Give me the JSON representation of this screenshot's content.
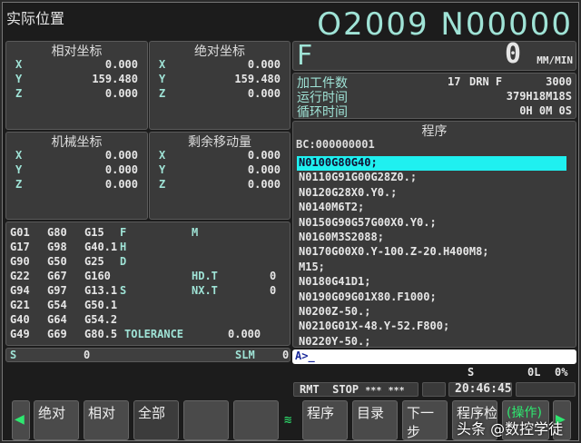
{
  "header": {
    "title": "实际位置",
    "program_no": "O2009 N00000"
  },
  "relative": {
    "title": "相对坐标",
    "axes": [
      {
        "a": "X",
        "v": "0.000"
      },
      {
        "a": "Y",
        "v": "159.480"
      },
      {
        "a": "Z",
        "v": "0.000"
      }
    ]
  },
  "absolute": {
    "title": "绝对坐标",
    "axes": [
      {
        "a": "X",
        "v": "0.000"
      },
      {
        "a": "Y",
        "v": "159.480"
      },
      {
        "a": "Z",
        "v": "0.000"
      }
    ]
  },
  "machine": {
    "title": "机械坐标",
    "axes": [
      {
        "a": "X",
        "v": "0.000"
      },
      {
        "a": "Y",
        "v": "0.000"
      },
      {
        "a": "Z",
        "v": "0.000"
      }
    ]
  },
  "remaining": {
    "title": "剩余移动量",
    "axes": [
      {
        "a": "X",
        "v": "0.000"
      },
      {
        "a": "Y",
        "v": "0.000"
      },
      {
        "a": "Z",
        "v": "0.000"
      }
    ]
  },
  "feed": {
    "label": "F",
    "value": "0",
    "unit": "MM/MIN"
  },
  "info": {
    "parts_label": "加工件数",
    "parts": "17",
    "drn_label": "DRN F",
    "drn": "3000",
    "run_label": "运行时间",
    "run": "379H18M18S",
    "cycle_label": "循环时间",
    "cycle": "0H 0M 0S"
  },
  "gcodes": {
    "c1": [
      "G01",
      "G17",
      "G90",
      "G22",
      "G94",
      "G21",
      "G40",
      "G49"
    ],
    "c2": [
      "G80",
      "G98",
      "G50",
      "G67",
      "G97",
      "G54",
      "G64",
      "G69"
    ],
    "c3": [
      "G15",
      "G40.1",
      "G25",
      "G160",
      "G13.1",
      "G50.1",
      "G54.2",
      "G80.5"
    ],
    "f": "F",
    "h": "H",
    "d": "D",
    "s": "S",
    "m": "M",
    "hdt_label": "HD.T",
    "hdt": "0",
    "nxt_label": "NX.T",
    "nxt": "0",
    "tol_label": "TOLERANCE",
    "tol": "0.000"
  },
  "spindle": {
    "s_label": "S",
    "s": "0",
    "slm_label": "SLM",
    "slm": "0"
  },
  "program": {
    "title": "程序",
    "bc": "BC:000000001",
    "lines": [
      "N0100G80G40;",
      "N0110G91G00G28Z0.;",
      "N0120G28X0.Y0.;",
      "N0140M6T2;",
      "N0150G90G57G00X0.Y0.;",
      "N0160M3S2088;",
      "N0170G00X0.Y-100.Z-20.H400M8;",
      "M15;",
      "N0180G41D1;",
      "N0190G09G01X80.F1000;",
      "N0200Z-50.;",
      "N0210G01X-48.Y-52.F800;",
      "N0220Y-50.;"
    ]
  },
  "input": {
    "prompt": "A>_"
  },
  "status": {
    "s": "S",
    "ol": "0L",
    "pct": "0%",
    "mode": "RMT",
    "state": "STOP",
    "a1": "***",
    "a2": "***",
    "time": "20:46:45"
  },
  "softkeys": [
    "绝对",
    "相对",
    "全部",
    "",
    "",
    "程序",
    "目录",
    "下一步",
    "程序检",
    "(操作)"
  ],
  "watermark": "头条 @数控学徒"
}
